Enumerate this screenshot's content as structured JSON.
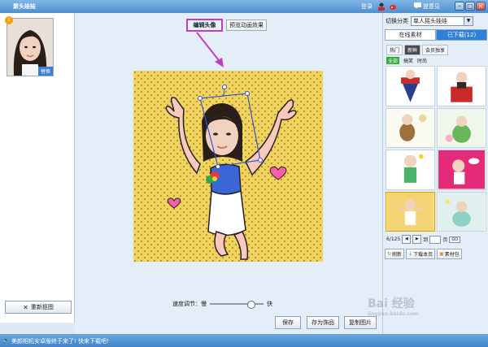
{
  "window": {
    "title": "聚头娃娃",
    "login": "登录",
    "feedback": "提意见",
    "btn_min": "–",
    "btn_max": "□",
    "btn_close": "×"
  },
  "left": {
    "avatar_badge": "1",
    "avatar_replace": "替换",
    "reset_button": "重新抠图"
  },
  "center": {
    "tab_edit": "编辑头像",
    "tab_preview": "预览动画效果",
    "speed_label": "速度调节：慢",
    "speed_fast": "快",
    "speed_value": 0.75,
    "buttons": [
      "保存",
      "存为饰品",
      "复制图片"
    ]
  },
  "right": {
    "category_label": "切换分类",
    "category_value": "单人摇头娃娃",
    "tabs": [
      "在线素材",
      "已下载(12)"
    ],
    "subtabs": [
      "热门",
      "新鲜",
      "会员独享"
    ],
    "active_subtab": "新鲜",
    "filters": [
      "全部",
      "搞笑",
      "时尚"
    ],
    "pager_text": "6/125",
    "pager_goto": "到",
    "pager_unit": "页",
    "pager_go": "GO",
    "tools": [
      "刷新",
      "下载本页",
      "素材包"
    ]
  },
  "status": {
    "message": "美颜相机安卓版终于来了! 快来下载吧!"
  },
  "watermark": {
    "main": "Bai 经验",
    "sub": "jingyan.baidu.com"
  },
  "colors": {
    "accent_blue": "#2f80d8",
    "highlight_magenta": "#c23ec1",
    "canvas_yellow": "#f2d35c"
  }
}
